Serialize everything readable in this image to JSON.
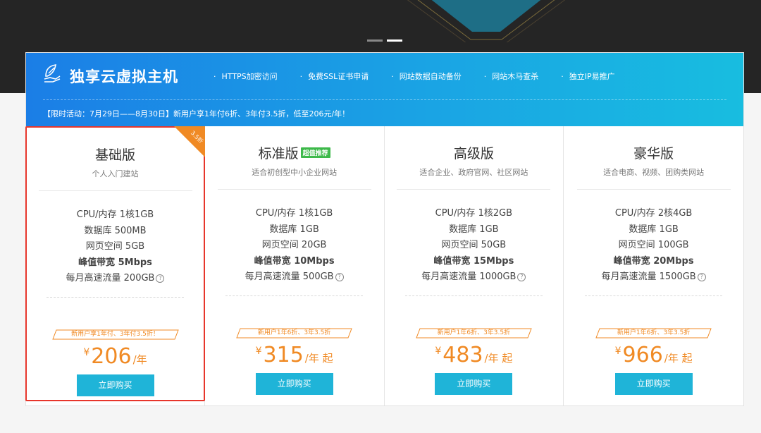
{
  "hero": {
    "slide_count": 2,
    "active_slide": 2
  },
  "banner": {
    "title": "独享云虚拟主机",
    "icon": "leaf-hand-icon",
    "features": [
      "HTTPS加密访问",
      "免费SSL证书申请",
      "网站数据自动备份",
      "网站木马查杀",
      "独立IP易推广"
    ],
    "promo": "【限时活动：7月29日——8月30日】新用户享1年付6折、3年付3.5折，低至206元/年！"
  },
  "plans": [
    {
      "name": "基础版",
      "badge": "",
      "corner": "3.5折",
      "subtitle": "个人入门建站",
      "specs": [
        "CPU/内存 1核1GB",
        "数据库 500MB",
        "网页空间 5GB"
      ],
      "bandwidth": "峰值带宽 5Mbps",
      "traffic": "每月高速流量 200GB",
      "discount": "新用户享1年付、3年付3.5折！",
      "currency": "¥",
      "price": "206",
      "unit": "/年",
      "buy": "立即购买"
    },
    {
      "name": "标准版",
      "badge": "超值推荐",
      "corner": "",
      "subtitle": "适合初创型中小企业网站",
      "specs": [
        "CPU/内存 1核1GB",
        "数据库 1GB",
        "网页空间 20GB"
      ],
      "bandwidth": "峰值带宽 10Mbps",
      "traffic": "每月高速流量 500GB",
      "discount": "新用户1年6折、3年3.5折",
      "currency": "¥",
      "price": "315",
      "unit": "/年 起",
      "buy": "立即购买"
    },
    {
      "name": "高级版",
      "badge": "",
      "corner": "",
      "subtitle": "适合企业、政府官网、社区网站",
      "specs": [
        "CPU/内存 1核2GB",
        "数据库 1GB",
        "网页空间 50GB"
      ],
      "bandwidth": "峰值带宽 15Mbps",
      "traffic": "每月高速流量 1000GB",
      "discount": "新用户1年6折、3年3.5折",
      "currency": "¥",
      "price": "483",
      "unit": "/年 起",
      "buy": "立即购买"
    },
    {
      "name": "豪华版",
      "badge": "",
      "corner": "",
      "subtitle": "适合电商、视频、团购类网站",
      "specs": [
        "CPU/内存 2核4GB",
        "数据库 1GB",
        "网页空间 100GB"
      ],
      "bandwidth": "峰值带宽 20Mbps",
      "traffic": "每月高速流量 1500GB",
      "discount": "新用户1年6折、3年3.5折",
      "currency": "¥",
      "price": "966",
      "unit": "/年 起",
      "buy": "立即购买"
    }
  ],
  "colors": {
    "accent": "#f08a24",
    "button": "#1fb4d8",
    "selected_border": "#e7362b",
    "badge": "#3db94a",
    "banner_start": "#1b7ee6",
    "banner_end": "#18bde0"
  }
}
